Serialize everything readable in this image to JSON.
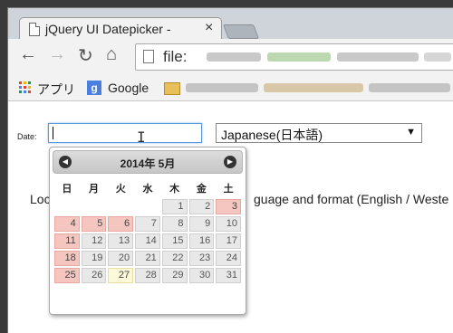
{
  "browser": {
    "tab_title": "jQuery UI Datepicker -",
    "tab_close": "×",
    "url": "file:",
    "bookmarks": [
      {
        "label": "アプリ",
        "icon": "apps-grid-icon"
      },
      {
        "label": "Google",
        "icon": "google-icon"
      }
    ]
  },
  "page": {
    "date_label": "Date:",
    "date_value": "",
    "language_select": "Japanese(日本語)",
    "body_text_pre": "Loc",
    "body_text_post": "guage and format (English / Weste"
  },
  "datepicker": {
    "title": "2014年 5月",
    "weekdays": [
      "日",
      "月",
      "火",
      "水",
      "木",
      "金",
      "土"
    ],
    "weeks": [
      [
        "",
        "",
        "",
        "",
        "1",
        "2",
        "3"
      ],
      [
        "4",
        "5",
        "6",
        "7",
        "8",
        "9",
        "10"
      ],
      [
        "11",
        "12",
        "13",
        "14",
        "15",
        "16",
        "17"
      ],
      [
        "18",
        "19",
        "20",
        "21",
        "22",
        "23",
        "24"
      ],
      [
        "25",
        "26",
        "27",
        "28",
        "29",
        "30",
        "31"
      ]
    ],
    "holidays": [
      "3",
      "4",
      "5",
      "6",
      "11",
      "18",
      "25"
    ],
    "today": "27",
    "colors": {
      "holiday": "#f5c6c0",
      "today": "#fcf8da",
      "default": "#e8e8e8"
    }
  }
}
